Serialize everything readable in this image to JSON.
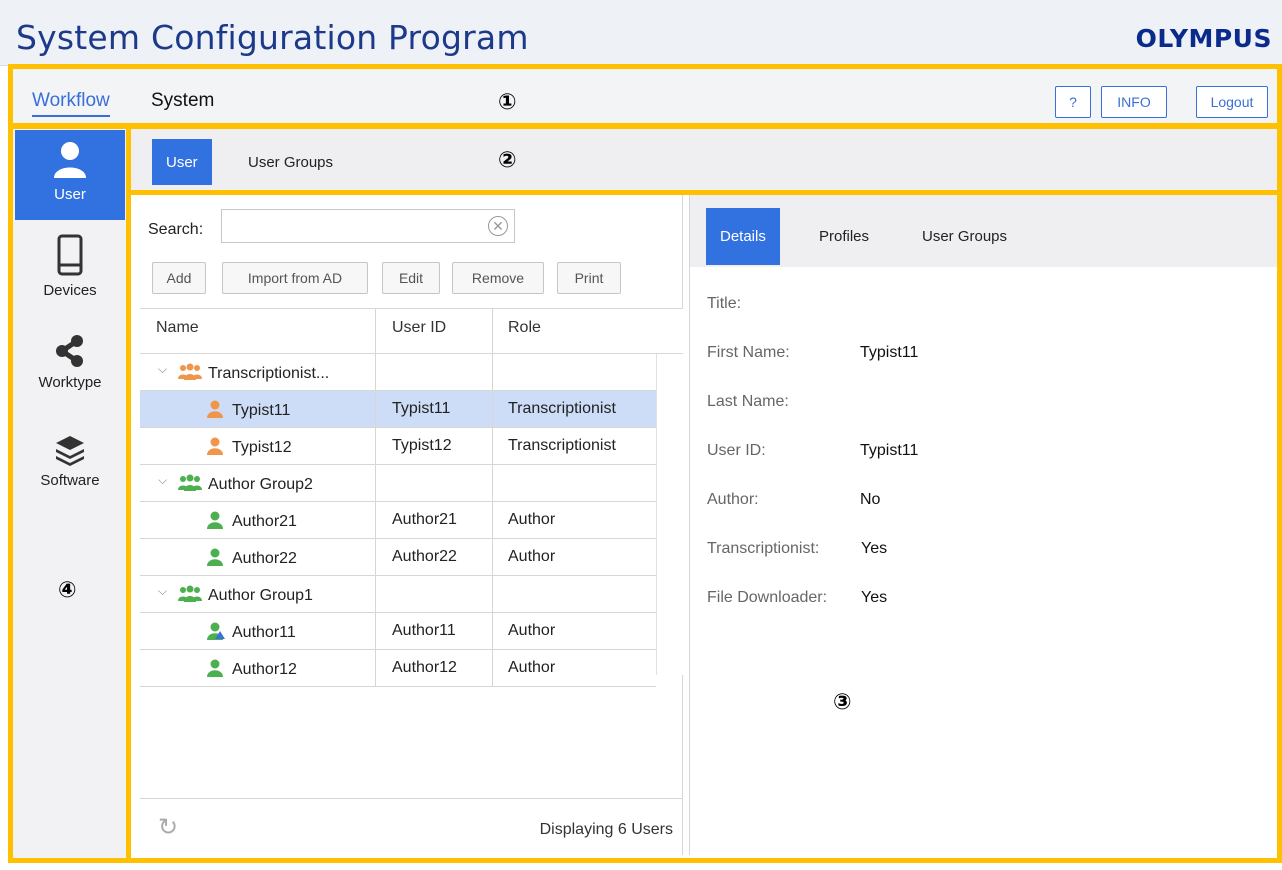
{
  "app": {
    "title": "System Configuration Program",
    "brand": "OLYMPUS"
  },
  "nav": {
    "workflow": "Workflow",
    "system": "System"
  },
  "top_buttons": {
    "help": "?",
    "info": "INFO",
    "logout": "Logout"
  },
  "callouts": {
    "c1": "①",
    "c2": "②",
    "c3": "③",
    "c4": "④"
  },
  "sidebar": {
    "items": [
      {
        "label": "User",
        "icon": "user-icon",
        "active": true
      },
      {
        "label": "Devices",
        "icon": "device-icon"
      },
      {
        "label": "Worktype",
        "icon": "share-icon"
      },
      {
        "label": "Software",
        "icon": "layers-icon"
      }
    ]
  },
  "subtabs": {
    "user": "User",
    "user_groups": "User Groups"
  },
  "list": {
    "search_label": "Search:",
    "search_value": "",
    "buttons": {
      "add": "Add",
      "import": "Import from AD",
      "edit": "Edit",
      "remove": "Remove",
      "print": "Print"
    },
    "columns": {
      "name": "Name",
      "user_id": "User ID",
      "role": "Role"
    },
    "rows": [
      {
        "type": "group",
        "name": "Transcriptionist...",
        "color": "orange"
      },
      {
        "type": "user",
        "name": "Typist11",
        "user_id": "Typist11",
        "role": "Transcriptionist",
        "color": "orange",
        "selected": true
      },
      {
        "type": "user",
        "name": "Typist12",
        "user_id": "Typist12",
        "role": "Transcriptionist",
        "color": "orange"
      },
      {
        "type": "group",
        "name": "Author Group2",
        "color": "green"
      },
      {
        "type": "user",
        "name": "Author21",
        "user_id": "Author21",
        "role": "Author",
        "color": "green"
      },
      {
        "type": "user",
        "name": "Author22",
        "user_id": "Author22",
        "role": "Author",
        "color": "green"
      },
      {
        "type": "group",
        "name": "Author Group1",
        "color": "green"
      },
      {
        "type": "user",
        "name": "Author11",
        "user_id": "Author11",
        "role": "Author",
        "color": "green",
        "badge": true
      },
      {
        "type": "user",
        "name": "Author12",
        "user_id": "Author12",
        "role": "Author",
        "color": "green"
      }
    ],
    "footer": "Displaying 6 Users"
  },
  "details": {
    "tabs": {
      "details": "Details",
      "profiles": "Profiles",
      "user_groups": "User Groups"
    },
    "fields": [
      {
        "label": "Title:",
        "value": ""
      },
      {
        "label": "First Name:",
        "value": "Typist11"
      },
      {
        "label": "Last Name:",
        "value": ""
      },
      {
        "label": "User ID:",
        "value": "Typist11"
      },
      {
        "label": "Author:",
        "value": "No"
      },
      {
        "label": "Transcriptionist:",
        "value": "Yes"
      },
      {
        "label": "File Downloader:",
        "value": "Yes"
      }
    ]
  },
  "colors": {
    "accent": "#3272e0",
    "highlight": "#ffc000",
    "brand": "#0a2a8c",
    "orange_user": "#f0954a",
    "green_user": "#4caf50"
  }
}
